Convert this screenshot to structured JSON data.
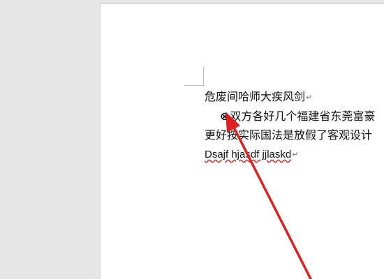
{
  "document": {
    "lines": [
      "危废间哈师大疾风剑",
      "双方各好几个福建省东莞富豪",
      "更好按实际国法是放假了客观设计",
      "Dsajf hjasdf jjlaskd"
    ],
    "inserted_symbol": "⊗",
    "paragraph_mark": "↵"
  },
  "annotation": {
    "arrow_color": "#e02020"
  }
}
